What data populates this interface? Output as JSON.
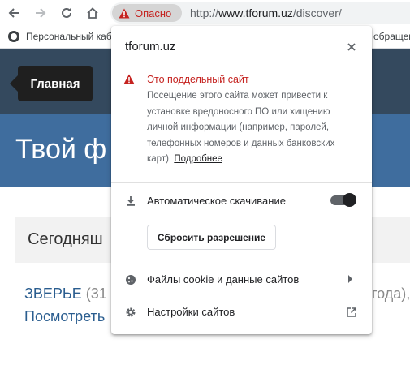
{
  "browser": {
    "security_chip_label": "Опасно",
    "url_scheme": "http://",
    "url_host": "www.tforum.uz",
    "url_path": "/discover/",
    "bookmarks": [
      {
        "label": "Персональный каб"
      },
      {
        "label": "обращен"
      }
    ]
  },
  "page": {
    "nav_home": "Главная",
    "hero_title": "Твой ф",
    "today_label": "Сегодняш",
    "topic_link": "ЗВЕРЬЕ",
    "topic_meta": " (31",
    "topic_right": "года),",
    "topic_line2": "Посмотреть"
  },
  "popup": {
    "host": "tforum.uz",
    "warning_title": "Это поддельный сайт",
    "warning_body": "Посещение этого сайта может привести к установке вредоносного ПО или хищению личной информации (например, паролей, телефонных номеров и данных банковских карт). ",
    "more_link": "Подробнее",
    "auto_download_label": "Автоматическое скачивание",
    "auto_download_enabled": true,
    "reset_button": "Сбросить разрешение",
    "cookies_label": "Файлы cookie и данные сайтов",
    "site_settings_label": "Настройки сайтов"
  },
  "colors": {
    "danger": "#c5221f",
    "nav_bg": "#34495e",
    "hero_bg": "#3f6d9e",
    "link": "#2a5d8f"
  }
}
